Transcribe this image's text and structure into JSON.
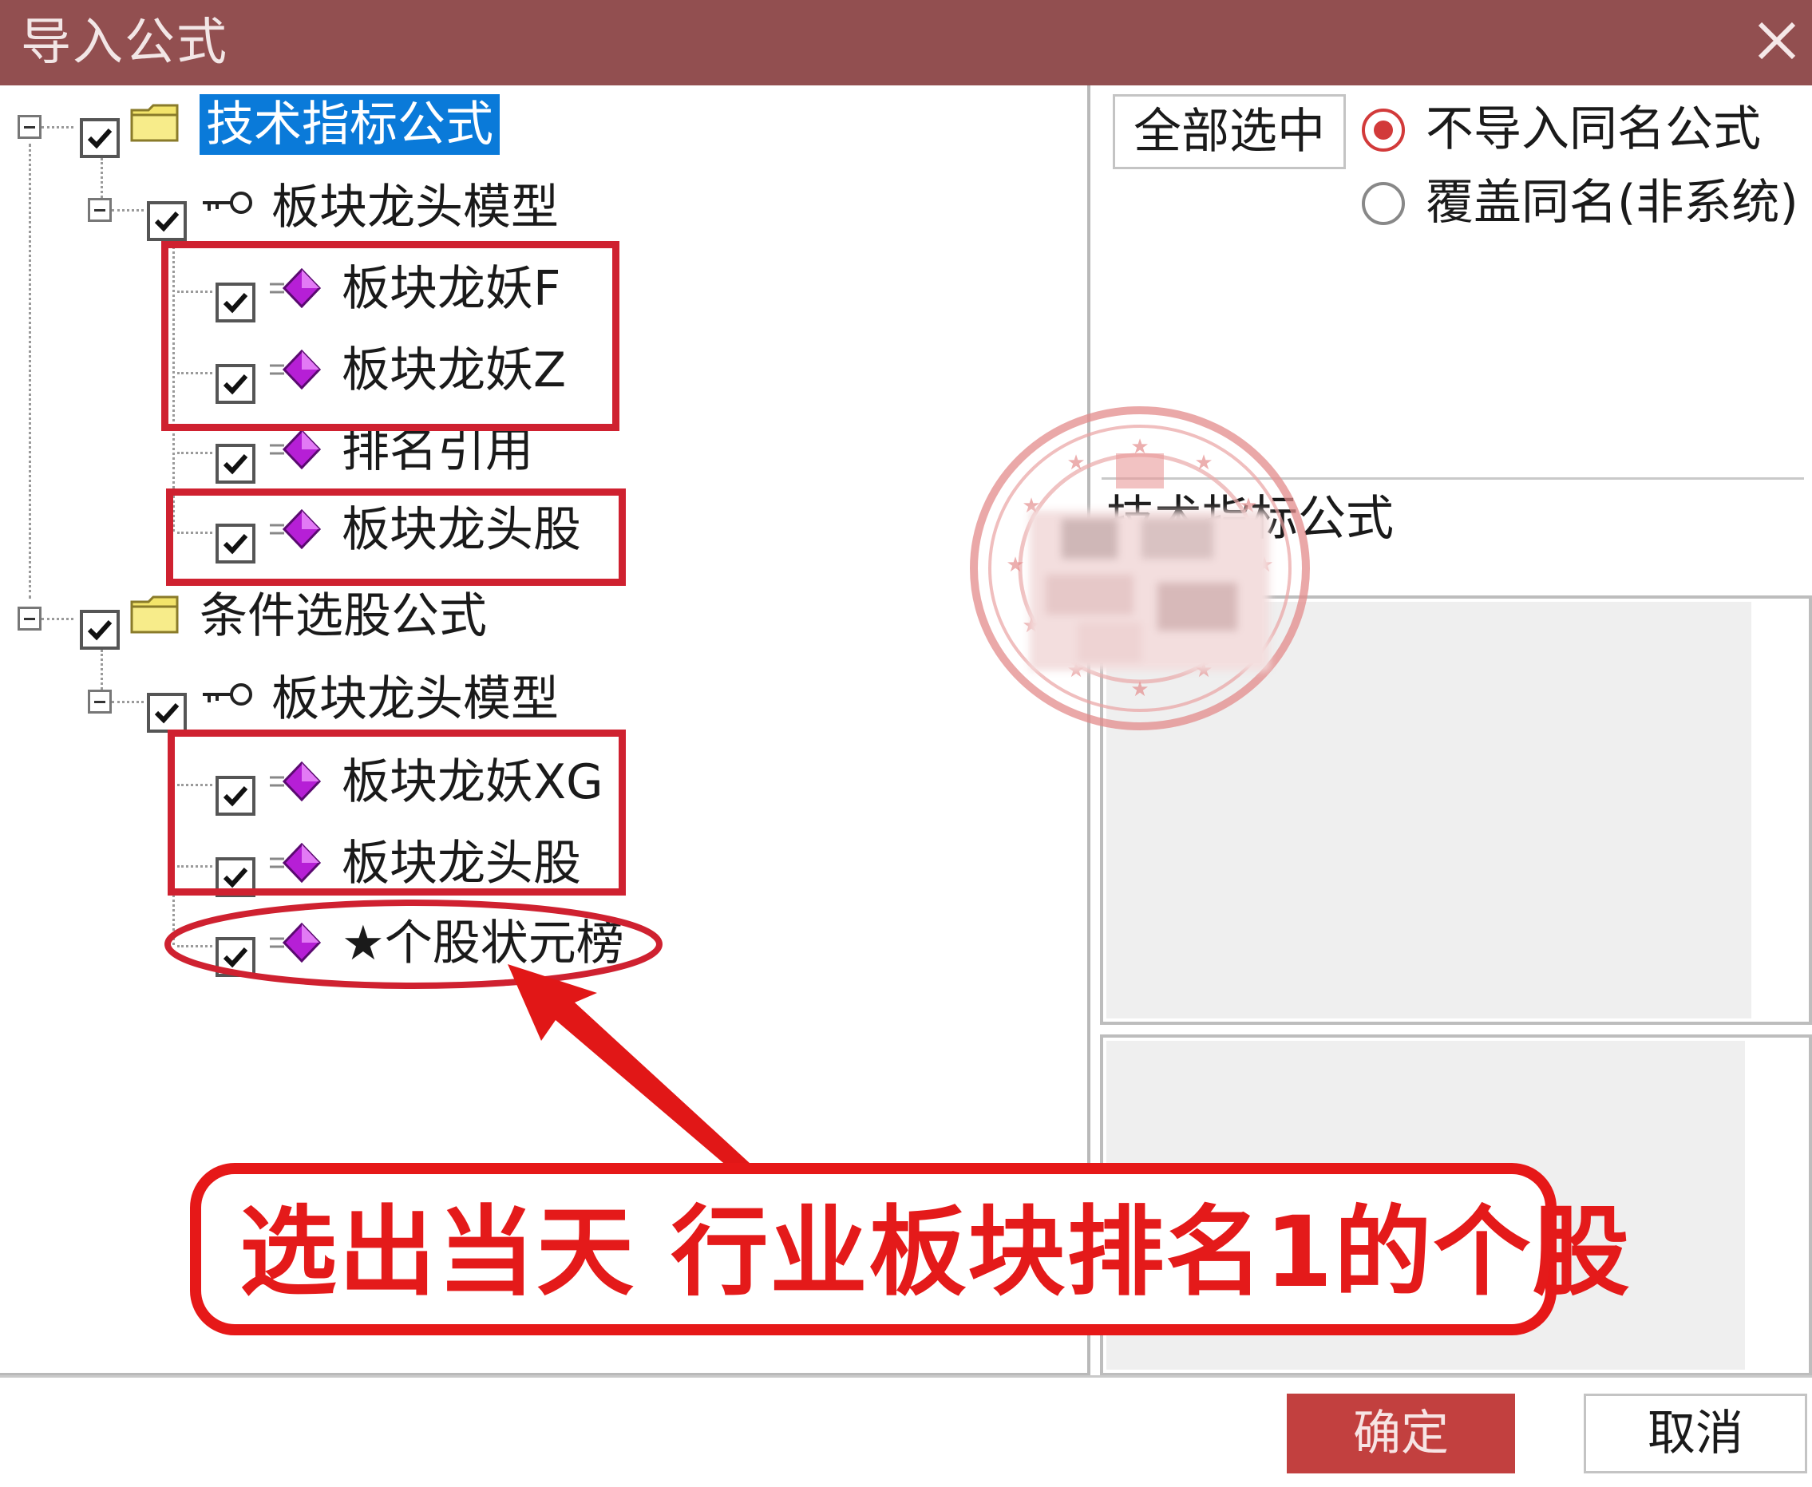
{
  "window": {
    "title": "导入公式",
    "close_icon": "close-icon"
  },
  "tree": {
    "groups": [
      {
        "label": "技术指标公式",
        "checked": true,
        "icon": "folder-icon",
        "subgroup": {
          "label": "板块龙头模型",
          "checked": true,
          "icon": "key-icon",
          "items": [
            {
              "label": "板块龙妖F",
              "checked": true,
              "icon": "gem-icon"
            },
            {
              "label": "板块龙妖Z",
              "checked": true,
              "icon": "gem-icon"
            },
            {
              "label": "排名引用",
              "checked": true,
              "icon": "gem-icon"
            },
            {
              "label": "板块龙头股",
              "checked": true,
              "icon": "gem-icon"
            }
          ]
        }
      },
      {
        "label": "条件选股公式",
        "checked": true,
        "icon": "folder-icon",
        "subgroup": {
          "label": "板块龙头模型",
          "checked": true,
          "icon": "key-icon",
          "items": [
            {
              "label": "板块龙妖XG",
              "checked": true,
              "icon": "gem-icon"
            },
            {
              "label": "板块龙头股",
              "checked": true,
              "icon": "gem-icon"
            },
            {
              "label": "★个股状元榜",
              "checked": true,
              "icon": "gem-icon"
            }
          ]
        }
      }
    ]
  },
  "right": {
    "select_all_label": "全部选中",
    "radio_options": [
      {
        "label": "不导入同名公式",
        "selected": true
      },
      {
        "label": "覆盖同名(非系统)",
        "selected": false
      }
    ],
    "current_path": "技术指标公式"
  },
  "buttons": {
    "ok_label": "确定",
    "cancel_label": "取消"
  },
  "annotation": {
    "caption": "选出当天 行业板块排名1的个股"
  },
  "colors": {
    "titlebar": "#924f50",
    "selection": "#0a7ad9",
    "annotation_red": "#e41a1a",
    "ok_button": "#c2403f"
  }
}
